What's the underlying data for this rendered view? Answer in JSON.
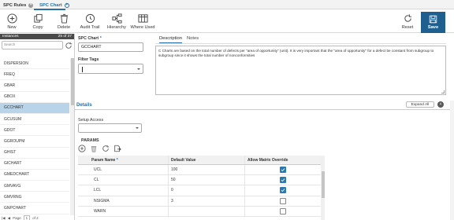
{
  "tabs": [
    {
      "label": "SPC Rules",
      "active": false
    },
    {
      "label": "SPC Chart",
      "active": true
    }
  ],
  "toolbar": {
    "new": "New",
    "copy": "Copy",
    "delete": "Delete",
    "audit_trail": "Audit Trail",
    "hierarchy": "Hierarchy",
    "where_used": "Where Used",
    "reset": "Reset",
    "save": "Save"
  },
  "left": {
    "header": "Instances",
    "count": "25 of 37",
    "search_placeholder": "Search",
    "items": [
      {
        "label": "DISPERSION",
        "selected": false
      },
      {
        "label": "FREQ",
        "selected": false
      },
      {
        "label": "GBAR",
        "selected": false
      },
      {
        "label": "GBOX",
        "selected": false
      },
      {
        "label": "GCCHART",
        "selected": true
      },
      {
        "label": "GCUSUM",
        "selected": false
      },
      {
        "label": "GDOT",
        "selected": false
      },
      {
        "label": "GGROUPM",
        "selected": false
      },
      {
        "label": "GHIST",
        "selected": false
      },
      {
        "label": "GICHART",
        "selected": false
      },
      {
        "label": "GMEDCHART",
        "selected": false
      },
      {
        "label": "GMVAVG",
        "selected": false
      },
      {
        "label": "GMVRNG",
        "selected": false
      },
      {
        "label": "GNPCHART",
        "selected": false
      }
    ],
    "pager": {
      "page_label": "Page",
      "page": "1",
      "of": "of 2"
    }
  },
  "form": {
    "spc_chart_label": "SPC Chart",
    "spc_chart_value": "GCCHART",
    "filter_tags_label": "Filter Tags",
    "setup_access_label": "Setup Access"
  },
  "description": {
    "tabs": [
      "Description",
      "Notes"
    ],
    "text": "C Charts are based on the total number of defects per \"area of opportunity\" (unit). It is very important that the \"area of opportunity\" for a defect be constant from subgroup to subgroup since it shows the total number of nonconformities"
  },
  "details": {
    "title": "Details",
    "expand_all": "Expand All"
  },
  "params": {
    "title": "PARAMS",
    "columns": [
      "Param Name",
      "Default Value",
      "Allow Matrix Override"
    ],
    "rows": [
      {
        "name": "UCL",
        "value": "100",
        "override": true
      },
      {
        "name": "CL",
        "value": "50",
        "override": true
      },
      {
        "name": "LCL",
        "value": "0",
        "override": true
      },
      {
        "name": "NSIGMA",
        "value": "3",
        "override": false
      },
      {
        "name": "WARN",
        "value": "",
        "override": false
      }
    ]
  },
  "colors": {
    "accent": "#2a6fa8",
    "save_bg": "#1f5f8f",
    "selected_row": "#b9d4e8",
    "checkbox_on": "#2a79b5"
  }
}
